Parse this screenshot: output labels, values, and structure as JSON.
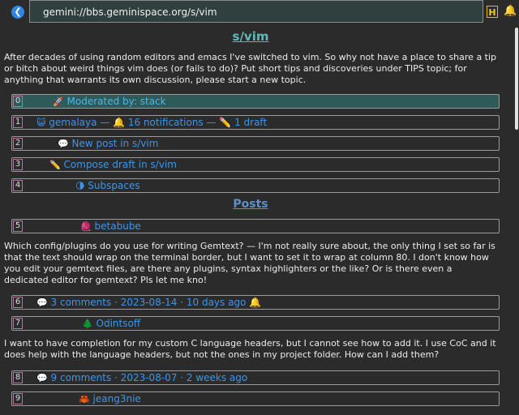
{
  "browser": {
    "url": "gemini://bbs.geminispace.org/s/vim",
    "back_glyph": "❮",
    "h_label": "H",
    "bell_glyph": "🔔"
  },
  "page": {
    "title": "s/vim",
    "intro": "After decades of using random editors and emacs I've switched to vim. So why not have a place to share a tip or bitch about weird things vim does (or fails to do)?   Put short tips and discoveries under TIPS topic; for anything that warrants its own discussion, please start a new topic.",
    "posts_heading": "Posts"
  },
  "links": [
    {
      "index": "0",
      "icon": "🚀",
      "text": "Moderated by: stack"
    },
    {
      "index": "1",
      "icon": "😺",
      "text": "gemalaya — 🔔 16 notifications — ✏️ 1 draft"
    },
    {
      "index": "2",
      "icon": "💬",
      "text": "New post in s/vim"
    },
    {
      "index": "3",
      "icon": "✏️",
      "text": "Compose draft in s/vim"
    },
    {
      "index": "4",
      "icon": "🌗",
      "text": "Subspaces"
    },
    {
      "index": "5",
      "icon": "🧶",
      "text": "betabube"
    },
    {
      "index": "6",
      "icon": "💬",
      "text": "3 comments · 2023-08-14 · 10 days ago 🔔"
    },
    {
      "index": "7",
      "icon": "🌲",
      "text": "Odintsoff"
    },
    {
      "index": "8",
      "icon": "💬",
      "text": "9 comments · 2023-08-07 · 2 weeks ago"
    },
    {
      "index": "9",
      "icon": "🦀",
      "text": "jeang3nie"
    }
  ],
  "posts": [
    {
      "body": "Which config/plugins do you use for writing Gemtext? — I'm not really sure about, the only thing I set so far is that the text should wrap on the terminal border, but I want to set it to wrap at column 80. I don't know how you edit your gemtext files, are there any plugins, syntax highlighters or the like? Or is there even a dedicated editor for gemtext? Pls let me kno!"
    },
    {
      "body": "I want to have completion for my custom C language headers, but I cannot see how to add it. I use CoC and it does help with the language headers, but not the ones in my project folder. How can I add them?"
    }
  ]
}
